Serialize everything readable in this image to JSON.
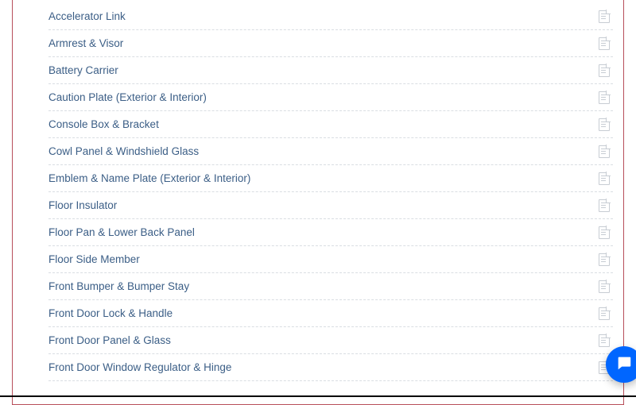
{
  "categories": [
    {
      "label": "Accelerator Link"
    },
    {
      "label": "Armrest & Visor"
    },
    {
      "label": "Battery Carrier"
    },
    {
      "label": "Caution Plate (Exterior & Interior)"
    },
    {
      "label": "Console Box & Bracket"
    },
    {
      "label": "Cowl Panel & Windshield Glass"
    },
    {
      "label": "Emblem & Name Plate (Exterior & Interior)"
    },
    {
      "label": "Floor Insulator"
    },
    {
      "label": "Floor Pan & Lower Back Panel"
    },
    {
      "label": "Floor Side Member"
    },
    {
      "label": "Front Bumper & Bumper Stay"
    },
    {
      "label": "Front Door Lock & Handle"
    },
    {
      "label": "Front Door Panel & Glass"
    },
    {
      "label": "Front Door Window Regulator & Hinge"
    }
  ],
  "icons": {
    "row_icon": "document-icon",
    "chat_icon": "chat-bubble-icon"
  }
}
